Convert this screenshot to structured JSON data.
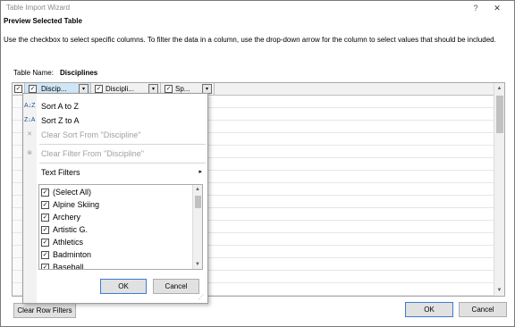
{
  "window": {
    "title": "Table Import Wizard",
    "help_label": "?",
    "close_label": "✕"
  },
  "heading": "Preview Selected Table",
  "description": "Use the checkbox to select specific columns. To filter the data in a column, use the drop-down arrow  for the column to select values that should be included.",
  "table_name": {
    "label": "Table Name:",
    "value": "Disciplines"
  },
  "columns": [
    {
      "label": "Discip...",
      "checked": "✓",
      "dropdown": "▾",
      "active": true
    },
    {
      "label": "Discipli...",
      "checked": "✓",
      "dropdown": "▾",
      "active": false
    },
    {
      "label": "Sp...",
      "checked": "✓",
      "dropdown": "▾",
      "active": false
    }
  ],
  "header_checkbox": "✓",
  "grid_scroll": {
    "up": "▲",
    "down": "▼"
  },
  "filter_menu": {
    "sort_asc": {
      "icon": "A↓Z",
      "label": "Sort A to Z"
    },
    "sort_desc": {
      "icon": "Z↓A",
      "label": "Sort Z to A"
    },
    "clear_sort": {
      "icon": "✕",
      "label": "Clear Sort From \"Discipline\""
    },
    "clear_filter": {
      "icon": "⊗",
      "label": "Clear Filter From \"Discipline\""
    },
    "text_filters": {
      "label": "Text Filters",
      "arrow": "▸"
    },
    "items": [
      {
        "label": "(Select All)",
        "checked": "✓"
      },
      {
        "label": "Alpine Skiing",
        "checked": "✓"
      },
      {
        "label": "Archery",
        "checked": "✓"
      },
      {
        "label": "Artistic G.",
        "checked": "✓"
      },
      {
        "label": "Athletics",
        "checked": "✓"
      },
      {
        "label": "Badminton",
        "checked": "✓"
      },
      {
        "label": "Baseball",
        "checked": "✓"
      }
    ],
    "list_scroll": {
      "up": "▲",
      "down": "▼"
    },
    "ok_label": "OK",
    "cancel_label": "Cancel",
    "grip": "⋰"
  },
  "footer": {
    "clear_row_filters": "Clear Row Filters",
    "ok_label": "OK",
    "cancel_label": "Cancel"
  }
}
